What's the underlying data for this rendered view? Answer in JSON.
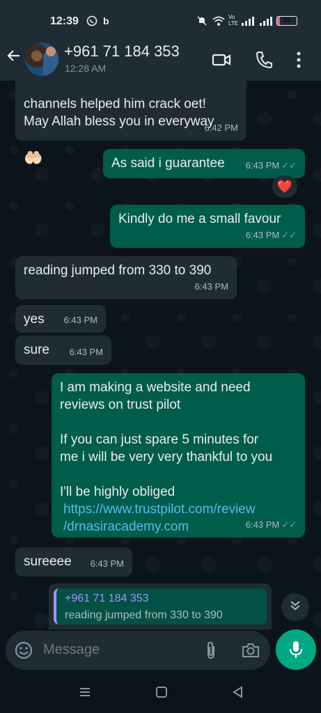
{
  "status_bar": {
    "time": "12:39",
    "battery": "15",
    "network_label": "Vo LTE"
  },
  "header": {
    "contact_name": "+961 71 184 353",
    "last_seen": "12:28 AM"
  },
  "messages": [
    {
      "direction": "in",
      "text": "channels helped him crack oet!\nMay Allah bless you in everyway",
      "emoji": "🤲🏻",
      "time": "6:42 PM"
    },
    {
      "direction": "out",
      "text": "As said i guarantee",
      "time": "6:43 PM",
      "reaction": "❤️"
    },
    {
      "direction": "out",
      "text": "Kindly do me a small favour",
      "time": "6:43 PM"
    },
    {
      "direction": "in",
      "text": "reading jumped from 330 to 390",
      "time": "6:43 PM"
    },
    {
      "direction": "in",
      "text": "yes",
      "time": "6:43 PM"
    },
    {
      "direction": "in",
      "text": "sure",
      "time": "6:43 PM"
    },
    {
      "direction": "out",
      "text_lines": [
        "I am making a website and need",
        "reviews on trust pilot",
        "",
        "If you can just spare 5 minutes for",
        "me i will be very very thankful to you",
        "",
        "I'll be highly obliged"
      ],
      "link": "https://www.trustpilot.com/review/drnasiracademy.com",
      "link_line1": "https://www.trustpilot.com/review",
      "link_line2": "/drnasiracademy.com",
      "time": "6:43 PM"
    },
    {
      "direction": "in",
      "text": "sureeee",
      "time": "6:43 PM"
    }
  ],
  "reply_preview": {
    "name": "+961 71 184 353",
    "text": "reading jumped from 330 to 390"
  },
  "composer": {
    "placeholder": "Message"
  },
  "colors": {
    "incoming_bubble": "#202c33",
    "outgoing_bubble": "#005c4b",
    "accent": "#00a884",
    "link": "#53bdeb"
  },
  "icons": [
    "back-arrow-icon",
    "video-call-icon",
    "phone-icon",
    "more-options-icon",
    "emoji-icon",
    "attach-icon",
    "camera-icon",
    "mic-icon",
    "scroll-down-icon",
    "read-ticks-icon"
  ]
}
